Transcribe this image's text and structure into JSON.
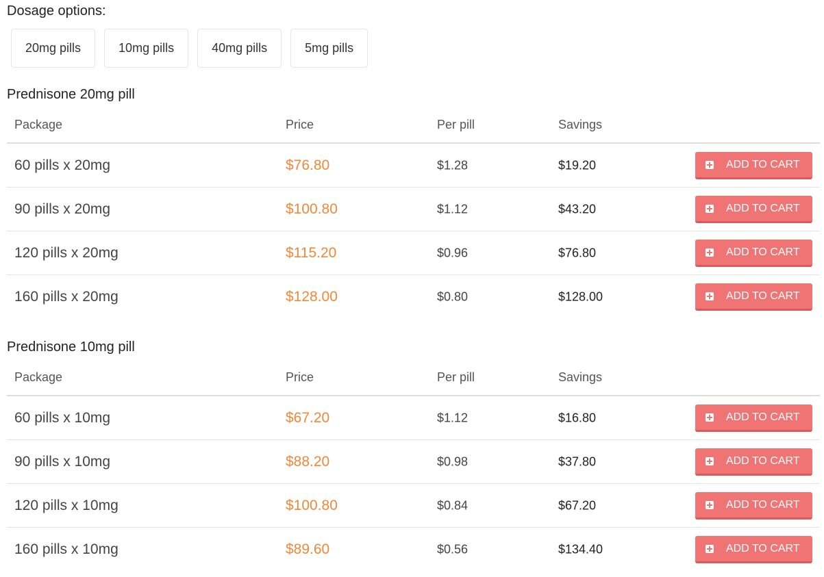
{
  "dosage": {
    "title": "Dosage options:",
    "options": [
      "20mg pills",
      "10mg pills",
      "40mg pills",
      "5mg pills"
    ]
  },
  "columns": {
    "package": "Package",
    "price": "Price",
    "per_pill": "Per pill",
    "savings": "Savings"
  },
  "cart_label": "ADD TO CART",
  "colors": {
    "price": "#f0883a",
    "cart_button": "#f07474"
  },
  "sections": [
    {
      "title": "Prednisone 20mg pill",
      "rows": [
        {
          "package": "60 pills x 20mg",
          "price": "$76.80",
          "per_pill": "$1.28",
          "savings": "$19.20"
        },
        {
          "package": "90 pills x 20mg",
          "price": "$100.80",
          "per_pill": "$1.12",
          "savings": "$43.20"
        },
        {
          "package": "120 pills x 20mg",
          "price": "$115.20",
          "per_pill": "$0.96",
          "savings": "$76.80"
        },
        {
          "package": "160 pills x 20mg",
          "price": "$128.00",
          "per_pill": "$0.80",
          "savings": "$128.00"
        }
      ]
    },
    {
      "title": "Prednisone 10mg pill",
      "rows": [
        {
          "package": "60 pills x 10mg",
          "price": "$67.20",
          "per_pill": "$1.12",
          "savings": "$16.80"
        },
        {
          "package": "90 pills x 10mg",
          "price": "$88.20",
          "per_pill": "$0.98",
          "savings": "$37.80"
        },
        {
          "package": "120 pills x 10mg",
          "price": "$100.80",
          "per_pill": "$0.84",
          "savings": "$67.20"
        },
        {
          "package": "160 pills x 10mg",
          "price": "$89.60",
          "per_pill": "$0.56",
          "savings": "$134.40"
        }
      ]
    }
  ]
}
